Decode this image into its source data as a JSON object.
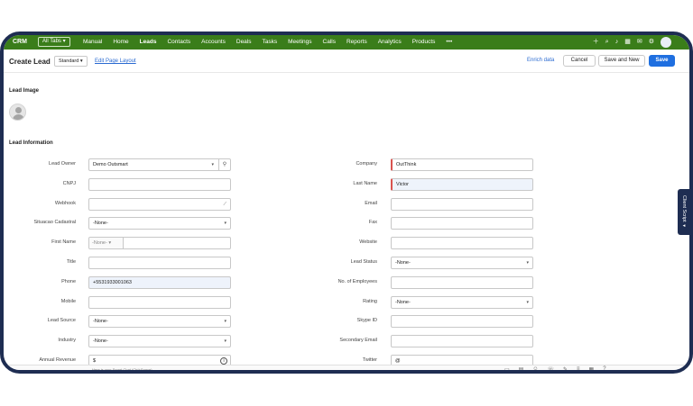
{
  "nav": {
    "brand": "CRM",
    "all_tabs": "All Tabs ▾",
    "tabs": [
      "Manual",
      "Home",
      "Leads",
      "Contacts",
      "Accounts",
      "Deals",
      "Tasks",
      "Meetings",
      "Calls",
      "Reports",
      "Analytics",
      "Products",
      "•••"
    ]
  },
  "toolbar": {
    "title": "Create Lead",
    "layout_select": "Standard",
    "edit_layout": "Edit Page Layout",
    "enrich": "Enrich data",
    "cancel": "Cancel",
    "save_and_new": "Save and New",
    "save": "Save"
  },
  "sections": {
    "lead_image": "Lead Image",
    "lead_information": "Lead Information"
  },
  "left_fields": [
    {
      "label": "Lead Owner",
      "value": "Demo Outsmart",
      "type": "owner"
    },
    {
      "label": "CNPJ",
      "value": "",
      "type": "text"
    },
    {
      "label": "Webhook",
      "value": "",
      "type": "textarea"
    },
    {
      "label": "Situacao Cadastral",
      "value": "-None-",
      "type": "select"
    },
    {
      "label": "First Name",
      "value": "-None-",
      "type": "salutation"
    },
    {
      "label": "Title",
      "value": "",
      "type": "text"
    },
    {
      "label": "Phone",
      "value": "+5531933001063",
      "type": "filled"
    },
    {
      "label": "Mobile",
      "value": "",
      "type": "text"
    },
    {
      "label": "Lead Source",
      "value": "-None-",
      "type": "select"
    },
    {
      "label": "Industry",
      "value": "-None-",
      "type": "select"
    },
    {
      "label": "Annual Revenue",
      "value": "$",
      "type": "currency"
    }
  ],
  "right_fields": [
    {
      "label": "Company",
      "value": "OutThink",
      "type": "required"
    },
    {
      "label": "Last Name",
      "value": "Victor",
      "type": "required-filled"
    },
    {
      "label": "Email",
      "value": "",
      "type": "text"
    },
    {
      "label": "Fax",
      "value": "",
      "type": "text"
    },
    {
      "label": "Website",
      "value": "",
      "type": "text"
    },
    {
      "label": "Lead Status",
      "value": "-None-",
      "type": "select"
    },
    {
      "label": "No. of Employees",
      "value": "",
      "type": "text"
    },
    {
      "label": "Rating",
      "value": "-None-",
      "type": "select"
    },
    {
      "label": "Skype ID",
      "value": "",
      "type": "text"
    },
    {
      "label": "Secondary Email",
      "value": "",
      "type": "text"
    },
    {
      "label": "Twitter",
      "value": "@",
      "type": "text"
    }
  ],
  "client_script": "Client Script ◂",
  "bottom_hint": "Here is your Smart Chat (Ctrl+Space)",
  "colors": {
    "nav": "#3a7d1a",
    "accent": "#1f6fe0",
    "frame": "#1e2d52",
    "required": "#d9534f"
  }
}
